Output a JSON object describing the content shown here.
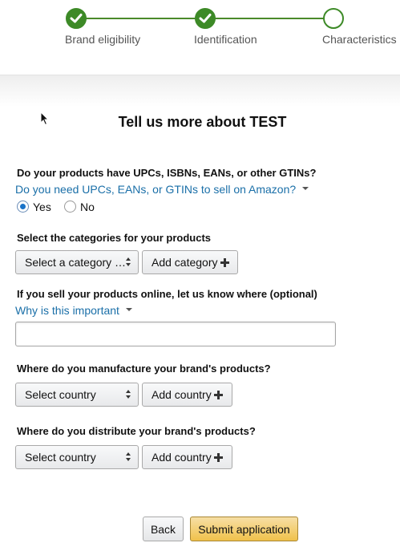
{
  "stepper": {
    "steps": [
      {
        "label": "Brand eligibility",
        "status": "complete"
      },
      {
        "label": "Identification",
        "status": "complete"
      },
      {
        "label": "Characteristics",
        "status": "current"
      }
    ],
    "accent_color": "#3d8a27"
  },
  "form": {
    "title": "Tell us more about TEST",
    "gtin": {
      "question": "Do your products have UPCs, ISBNs, EANs, or other GTINs?",
      "help_link": "Do you need UPCs, EANs, or GTINs to sell on Amazon?",
      "options": [
        {
          "label": "Yes",
          "selected": true
        },
        {
          "label": "No",
          "selected": false
        }
      ]
    },
    "categories": {
      "question": "Select the categories for your products",
      "select_value": "Select a category …",
      "add_label": "Add category"
    },
    "online": {
      "question": "If you sell your products online, let us know where (optional)",
      "help_link": "Why is this important",
      "input_value": ""
    },
    "manufacture": {
      "question": "Where do you manufacture your brand's products?",
      "select_value": "Select country",
      "add_label": "Add country"
    },
    "distribute": {
      "question": "Where do you distribute your brand's products?",
      "select_value": "Select country",
      "add_label": "Add country"
    }
  },
  "actions": {
    "back_label": "Back",
    "submit_label": "Submit application",
    "submit_color": "#f0c14b"
  },
  "colors": {
    "link": "#1a6fa8",
    "radio_selected": "#1a73c8"
  }
}
